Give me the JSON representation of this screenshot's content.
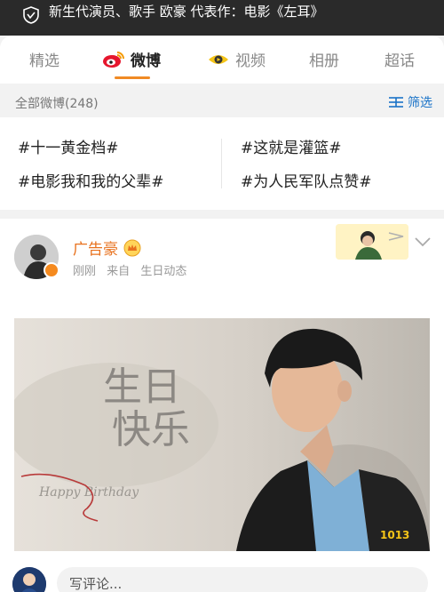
{
  "topbar": {
    "bio": "新生代演员、歌手 欧豪 代表作：电影《左耳》"
  },
  "tabs": [
    {
      "label": "精选"
    },
    {
      "label": "微博"
    },
    {
      "label": "视频"
    },
    {
      "label": "相册"
    },
    {
      "label": "超话"
    }
  ],
  "filterbar": {
    "count": "全部微博(248)",
    "filter_label": "筛选"
  },
  "topics": [
    "#十一黄金档#",
    "#这就是灌篮#",
    "#电影我和我的父辈#",
    "#为人民军队点赞#"
  ],
  "post": {
    "username": "广告豪",
    "time": "刚刚",
    "source_prefix": "来自",
    "source": "生日动态",
    "photo": {
      "headline_1": "生日",
      "headline_small": "快乐",
      "script": "Happy Birthday",
      "number": "1013"
    }
  },
  "comment": {
    "placeholder": "写评论..."
  },
  "colors": {
    "accent": "#f08a24",
    "link": "#1a73c8",
    "username": "#e8711d"
  },
  "icons": [
    "verified-shield-icon",
    "weibo-icon",
    "video-icon",
    "filter-icon",
    "crown-icon",
    "chevron-down-icon"
  ]
}
